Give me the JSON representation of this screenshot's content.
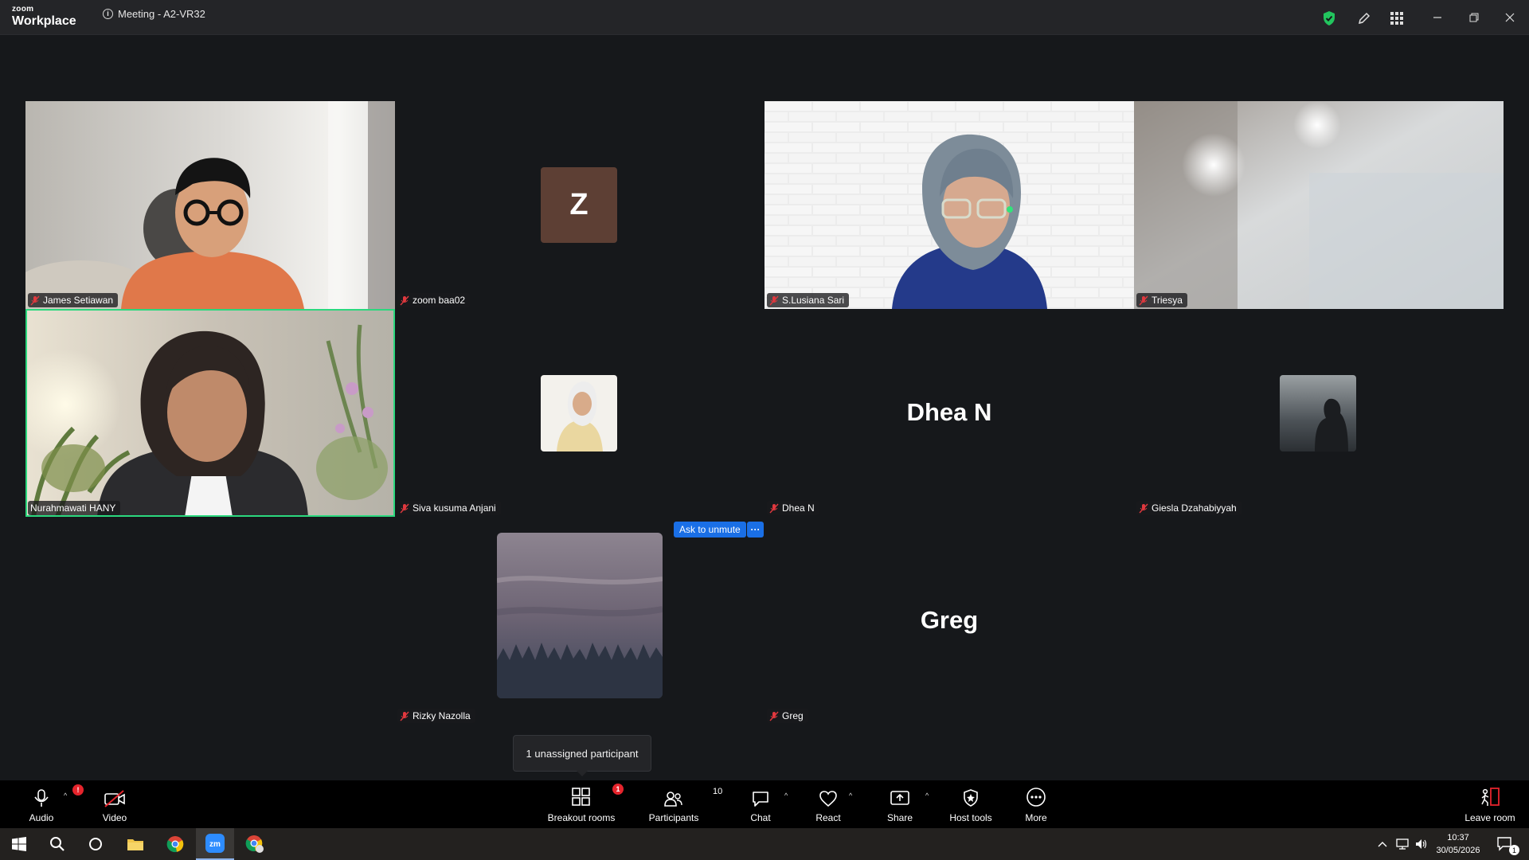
{
  "app": {
    "brand_small": "zoom",
    "brand_large": "Workplace",
    "meeting_title": "Meeting - A2-VR32"
  },
  "participants": [
    {
      "name": "James Setiawan",
      "display": "video"
    },
    {
      "name": "zoom baa02",
      "display": "letter",
      "initial": "Z"
    },
    {
      "name": "S.Lusiana Sari",
      "display": "video"
    },
    {
      "name": "Triesya",
      "display": "video"
    },
    {
      "name": "Nurahmawati HANY",
      "display": "video",
      "active_speaker": true
    },
    {
      "name": "Siva kusuma Anjani",
      "display": "photo"
    },
    {
      "name": "Dhea N",
      "display": "name",
      "big_label": "Dhea N"
    },
    {
      "name": "Giesla Dzahabiyyah",
      "display": "photo"
    },
    {
      "name": "Rizky Nazolla",
      "display": "photo"
    },
    {
      "name": "Greg",
      "display": "name",
      "big_label": "Greg"
    }
  ],
  "ask_to_unmute": {
    "label": "Ask to unmute",
    "more": "···"
  },
  "tooltip": "1 unassigned participant",
  "toolbar": {
    "audio": "Audio",
    "video": "Video",
    "breakout": "Breakout rooms",
    "breakout_badge": "1",
    "participants": "Participants",
    "participants_count": "10",
    "chat": "Chat",
    "react": "React",
    "share": "Share",
    "host_tools": "Host tools",
    "more": "More",
    "leave": "Leave room"
  },
  "taskbar": {
    "time": "10:37",
    "date": "30/05/2026",
    "notification_count": "1"
  },
  "colors": {
    "background": "#16181b",
    "active_speaker": "#2bd87e",
    "accent_blue": "#1a6fe6",
    "badge_red": "#e5242c",
    "shield_green": "#22c55e"
  }
}
